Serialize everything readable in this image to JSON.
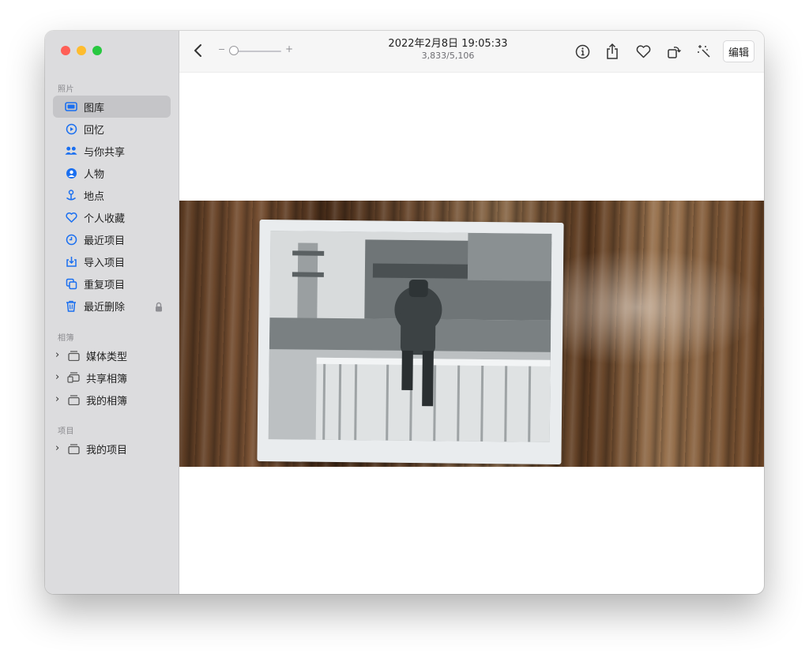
{
  "window": {
    "toolbar": {
      "date": "2022年2月8日 19:05:33",
      "count": "3,833/5,106",
      "zoom_minus": "−",
      "zoom_plus": "+",
      "zoom_level": 0.0,
      "edit_label": "编辑",
      "icons": [
        "chevron-left-icon",
        "info-icon",
        "share-icon",
        "heart-icon",
        "rotate-icon",
        "magic-wand-icon"
      ]
    },
    "sidebar": {
      "section_photos": "照片",
      "items": [
        {
          "label": "图库",
          "icon": "photo-library-icon",
          "selected": true
        },
        {
          "label": "回忆",
          "icon": "memories-icon"
        },
        {
          "label": "与你共享",
          "icon": "shared-with-you-icon"
        },
        {
          "label": "人物",
          "icon": "person-icon"
        },
        {
          "label": "地点",
          "icon": "location-pin-icon"
        },
        {
          "label": "个人收藏",
          "icon": "heart-icon"
        },
        {
          "label": "最近项目",
          "icon": "clock-icon"
        },
        {
          "label": "导入项目",
          "icon": "import-icon"
        },
        {
          "label": "重复项目",
          "icon": "duplicate-icon"
        },
        {
          "label": "最近删除",
          "icon": "trash-icon",
          "locked": true
        }
      ],
      "section_albums": "相簿",
      "albums": [
        {
          "label": "媒体类型",
          "icon": "folder-icon"
        },
        {
          "label": "共享相簿",
          "icon": "shared-folder-icon"
        },
        {
          "label": "我的相簿",
          "icon": "folder-icon"
        }
      ],
      "section_projects": "项目",
      "projects": [
        {
          "label": "我的项目",
          "icon": "folder-icon"
        }
      ]
    },
    "accent_color": "#1a6ff0"
  }
}
